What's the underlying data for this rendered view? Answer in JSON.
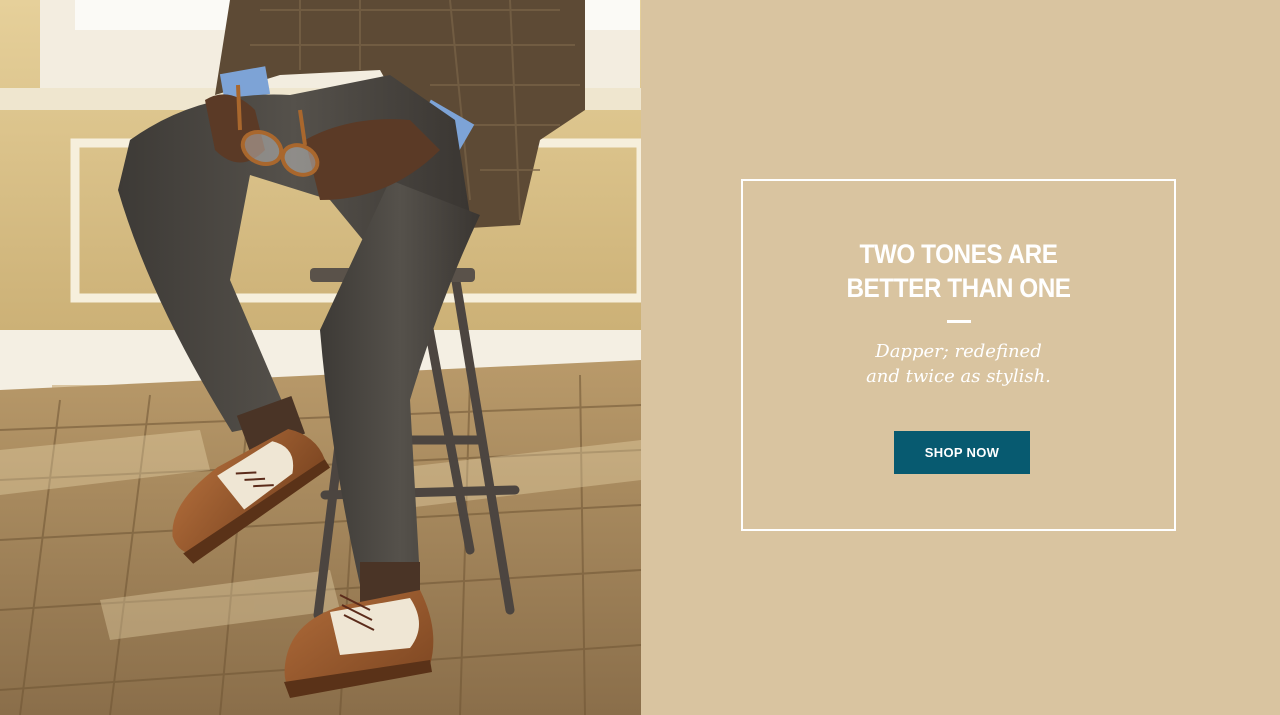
{
  "hero": {
    "image_description_icon": "man-in-two-tone-wingtip-shoes-photo"
  },
  "promo": {
    "title_line1": "TWO TONES ARE",
    "title_line2": "BETTER THAN ONE",
    "subtitle_line1": "Dapper; redefined",
    "subtitle_line2": "and twice as stylish.",
    "cta_label": "SHOP NOW"
  },
  "colors": {
    "panel_background": "#d9c4a0",
    "border": "#ffffff",
    "button_background": "#075a70",
    "text": "#ffffff"
  }
}
